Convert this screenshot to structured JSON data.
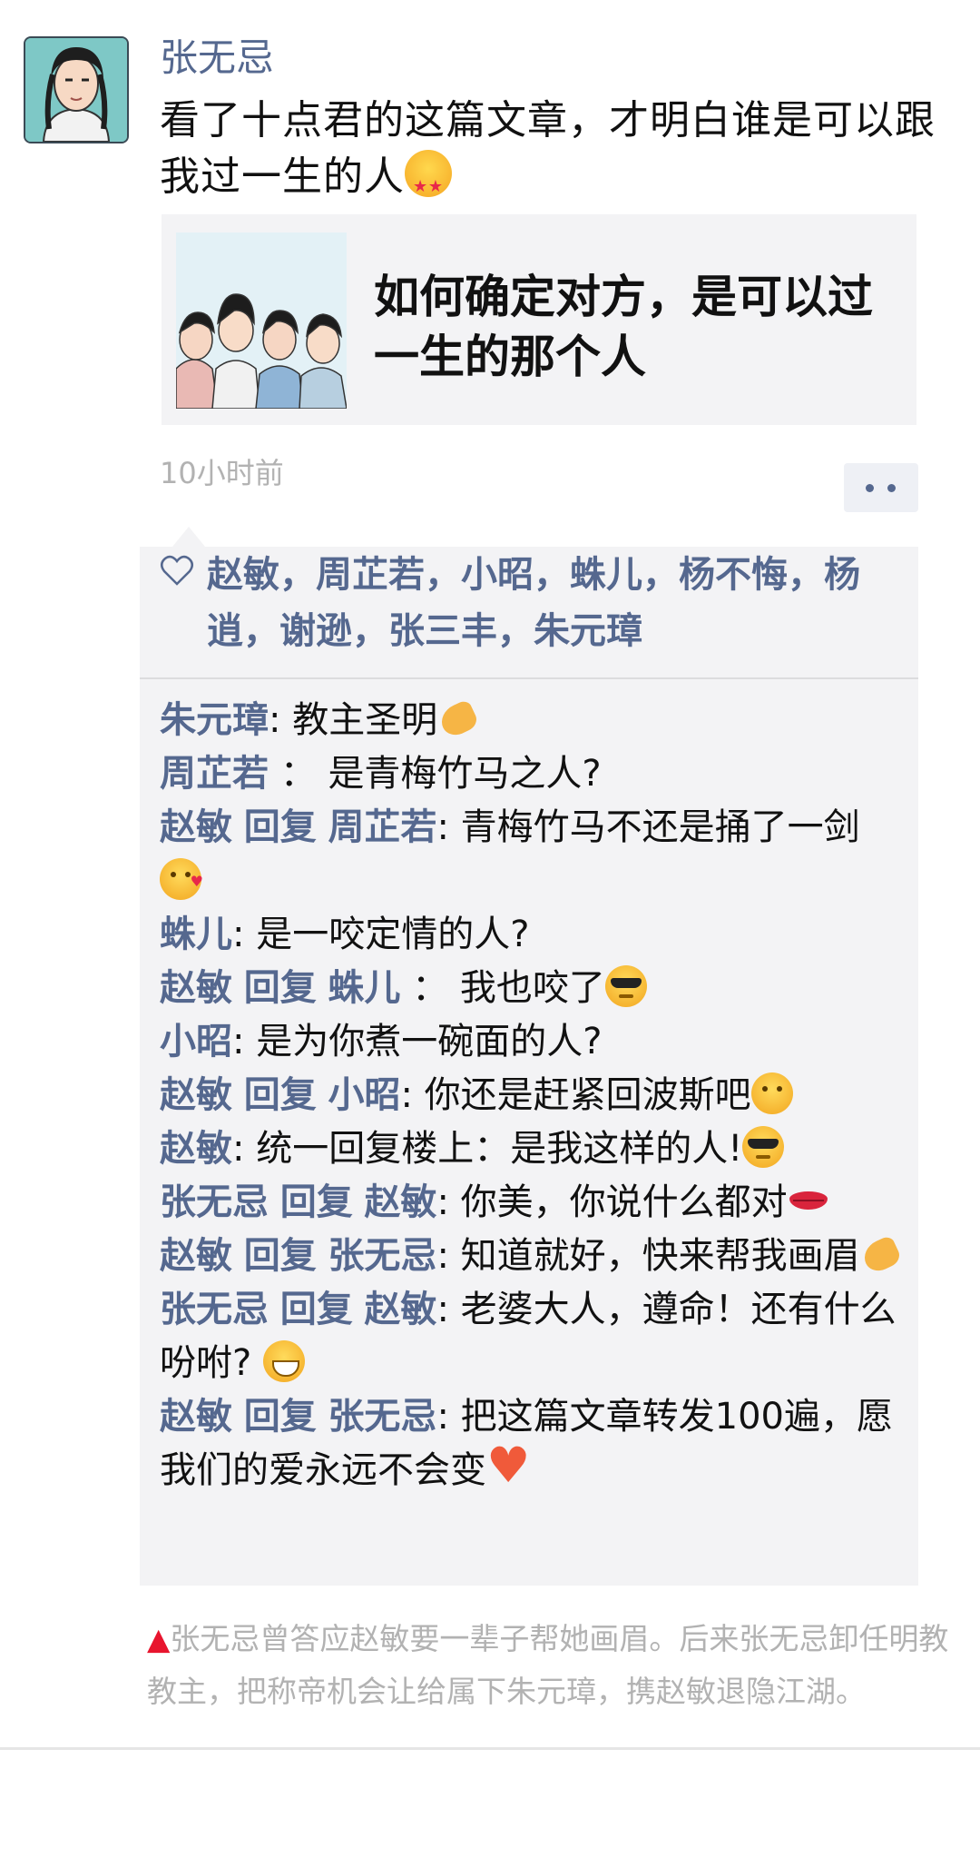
{
  "post": {
    "author": "张无忌",
    "text": "看了十点君的这篇文章，才明白谁是可以跟我过一生的人",
    "emoji": "star-struck",
    "time": "10小时前"
  },
  "share": {
    "title": "如何确定对方，是可以过一生的那个人"
  },
  "likes": {
    "text": "赵敏，周芷若，小昭，蛛儿，杨不悔，杨逍，谢逊，张三丰，朱元璋"
  },
  "comments": [
    {
      "name": "朱元璋",
      "reply_to": "",
      "sep": ": ",
      "text": "教主圣明",
      "emoji": "hand"
    },
    {
      "name": "周芷若",
      "reply_to": "",
      "sep": " ： ",
      "text": "是青梅竹马之人?",
      "emoji": ""
    },
    {
      "name": "赵敏",
      "reply_to": "周芷若",
      "sep": ": ",
      "text": "青梅竹马不还是捅了一剑 ",
      "emoji": "kiss"
    },
    {
      "name": "蛛儿",
      "reply_to": "",
      "sep": ": ",
      "text": "是一咬定情的人?",
      "emoji": ""
    },
    {
      "name": "赵敏",
      "reply_to": "蛛儿",
      "sep": " ： ",
      "text": "我也咬了",
      "emoji": "cool"
    },
    {
      "name": "小昭",
      "reply_to": "",
      "sep": ": ",
      "text": "是为你煮一碗面的人?",
      "emoji": ""
    },
    {
      "name": "赵敏",
      "reply_to": "小昭",
      "sep": ": ",
      "text": "你还是赶紧回波斯吧",
      "emoji": "think"
    },
    {
      "name": "赵敏",
      "reply_to": "",
      "sep": ": ",
      "text": "统一回复楼上：是我这样的人!",
      "emoji": "cool"
    },
    {
      "name": "张无忌",
      "reply_to": "赵敏",
      "sep": ": ",
      "text": "你美，你说什么都对",
      "emoji": "lips"
    },
    {
      "name": "赵敏",
      "reply_to": "张无忌",
      "sep": ": ",
      "text": "知道就好，快来帮我画眉",
      "emoji": "hand"
    },
    {
      "name": "张无忌",
      "reply_to": "赵敏",
      "sep": ": ",
      "text": "老婆大人，遵命！还有什么吩咐? ",
      "emoji": "grin"
    },
    {
      "name": "赵敏",
      "reply_to": "张无忌",
      "sep": ": ",
      "text": "把这篇文章转发100遍，愿我们的爱永远不会变",
      "emoji": "heart2"
    }
  ],
  "reply_word": "回复",
  "caption": {
    "marker": "▲",
    "text": "张无忌曾答应赵敏要一辈子帮她画眉。后来张无忌卸任明教教主，把称帝机会让给属下朱元璋，携赵敏退隐江湖。"
  },
  "colors": {
    "name_blue": "#55688f",
    "time_gray": "#b2b2b2",
    "comment_bg": "#f3f3f5",
    "caption_marker": "#e8152e"
  }
}
